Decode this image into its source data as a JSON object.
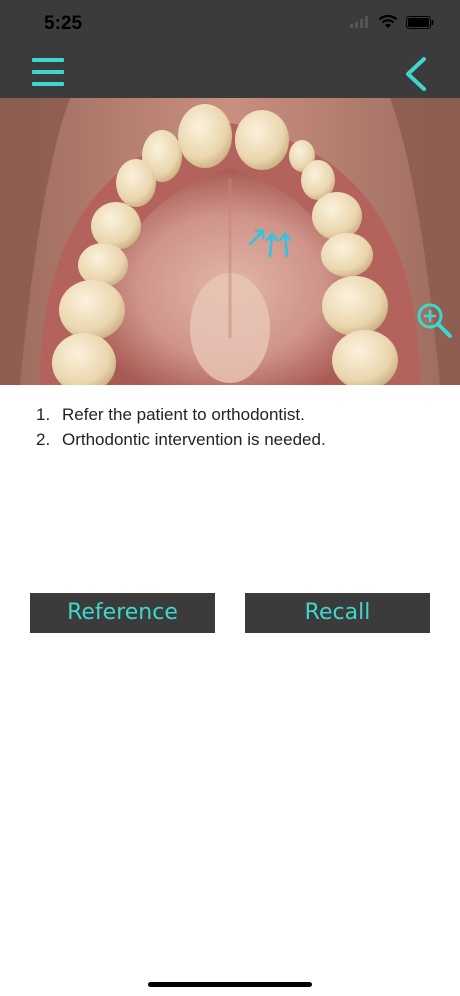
{
  "status_bar": {
    "time": "5:25",
    "icons": [
      "signal-icon",
      "wifi-icon",
      "battery-icon"
    ]
  },
  "nav": {
    "menu_icon": "hamburger-menu-icon",
    "back_icon": "chevron-left-icon",
    "accent_color": "#3fd6d0",
    "bar_color": "#3b3b3b"
  },
  "image": {
    "zoom_icon": "zoom-in-icon"
  },
  "instructions": [
    {
      "number": "1.",
      "text": "Refer the patient to orthodontist."
    },
    {
      "number": "2.",
      "text": "Orthodontic intervention is needed."
    }
  ],
  "buttons": {
    "reference_label": "Reference",
    "recall_label": "Recall"
  }
}
